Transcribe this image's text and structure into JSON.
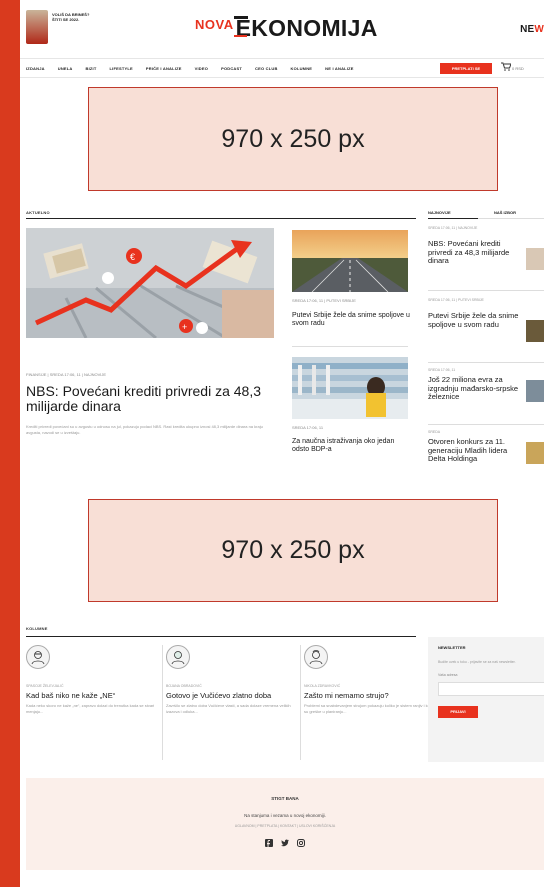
{
  "header": {
    "promo_text": "VOLIŠ DA BRINEŠ? ŠTITI SE 2022.",
    "logo_prefix": "NOVA",
    "logo_main": "EKONOMIJA",
    "badge_black": "NE",
    "badge_red": "W"
  },
  "nav": {
    "items": [
      "IZDANJA",
      "UNELA",
      "BIZIT",
      "LIFESTYLE",
      "PRIČE I ANALIZE",
      "VIDEO",
      "PODCAST",
      "CEO CLUB",
      "KOLUMNE",
      "NE I ANALIZE"
    ],
    "subscribe": "PRETPLATI SE",
    "cart_text": "0 RSD"
  },
  "ads": {
    "top": "970 x 250 px",
    "middle": "970 x 250 px"
  },
  "aktuelno": {
    "label": "AKTUELNO",
    "hero": {
      "meta": "FINANSIJE | SREDA 17:06, 11 | NAJNOVIJE",
      "title": "NBS: Povećani krediti privredi za 48,3 milijarde dinara",
      "excerpt": "Krediti privredi povećani su u avgustu u odnosu na jul, pokazuju podaci NBS. Rast kredita ukupno iznosi 48,3 milijarde dinara na kraju avgusta, navodi se u izveštaju."
    },
    "middle": [
      {
        "meta": "SREDA 17:06, 11 | PUTEVI SRBIJE",
        "title": "Putevi Srbije žele da snime spoljove u svom radu"
      },
      {
        "meta": "SREDA 17:06, 11",
        "title": "Za naučna istraživanja oko jedan odsto BDP-a"
      }
    ]
  },
  "sidebar": {
    "tab_latest": "NAJNOVIJE",
    "tab_picks": "NAŠ IZBOR",
    "items": [
      {
        "meta": "SREDA 17:06, 11 | NAJNOVIJE",
        "title": "NBS: Povećani krediti privredi za 48,3 milijarde dinara"
      },
      {
        "meta": "SREDA 17:06, 11 | PUTEVI SRBIJE",
        "title": "Putevi Srbije žele da snime spoljove u svom radu"
      },
      {
        "meta": "SREDA 17:06, 11",
        "title": "Još 22 miliona evra za izgradnju mađarsko-srpske železnice"
      },
      {
        "meta": "SREDA",
        "title": "Otvoren konkurs za 11. generaciju Mladih lidera Delta Holdinga"
      }
    ]
  },
  "kolumne": {
    "label": "KOLUMNE",
    "items": [
      {
        "author": "SPASOJE ŽELEVJALIĆ",
        "title": "Kad baš niko ne kaže „NE“",
        "text": "Kada neko skoro ne kaže „ne“, zapravo dolazi do trenutka kada se stvari menjaju..."
      },
      {
        "author": "BOJANA OBRADOVIĆ",
        "title": "Gotovo je Vučićevo zlatno doba",
        "text": "Završilo se zlatno doba Vučićeve vlasti, a sada dolaze vremena velikih izazova i odluka..."
      },
      {
        "author": "NIKOLA ZDRAVKOVIĆ",
        "title": "Zašto mi nemamo strujo?",
        "text": "Problemi sa snabdevanjem strujom pokazuju koliko je sistem ranjiv i kolike su greške u planiranju..."
      }
    ]
  },
  "newsletter": {
    "title": "NEWSLETTER",
    "text": "Budite uvek u toku - prijavite se za naš newsletter.",
    "label": "Vaša adresa",
    "button": "PRIJAVI"
  },
  "footer": {
    "title": "STIGT BANA",
    "line1": "Na stanjuma i vezama u novoj ekonomiji.",
    "line2": "UGLAVNOM | PRETPLATA | KONTAKT | USLOVI KORIŠĆENJA",
    "icons": [
      "facebook-icon",
      "twitter-icon",
      "instagram-icon"
    ]
  },
  "colors": {
    "accent": "#e8321e",
    "frame": "#d93a1e",
    "ad_fill": "#f8dfd6",
    "footer_bg": "#fbefea"
  }
}
